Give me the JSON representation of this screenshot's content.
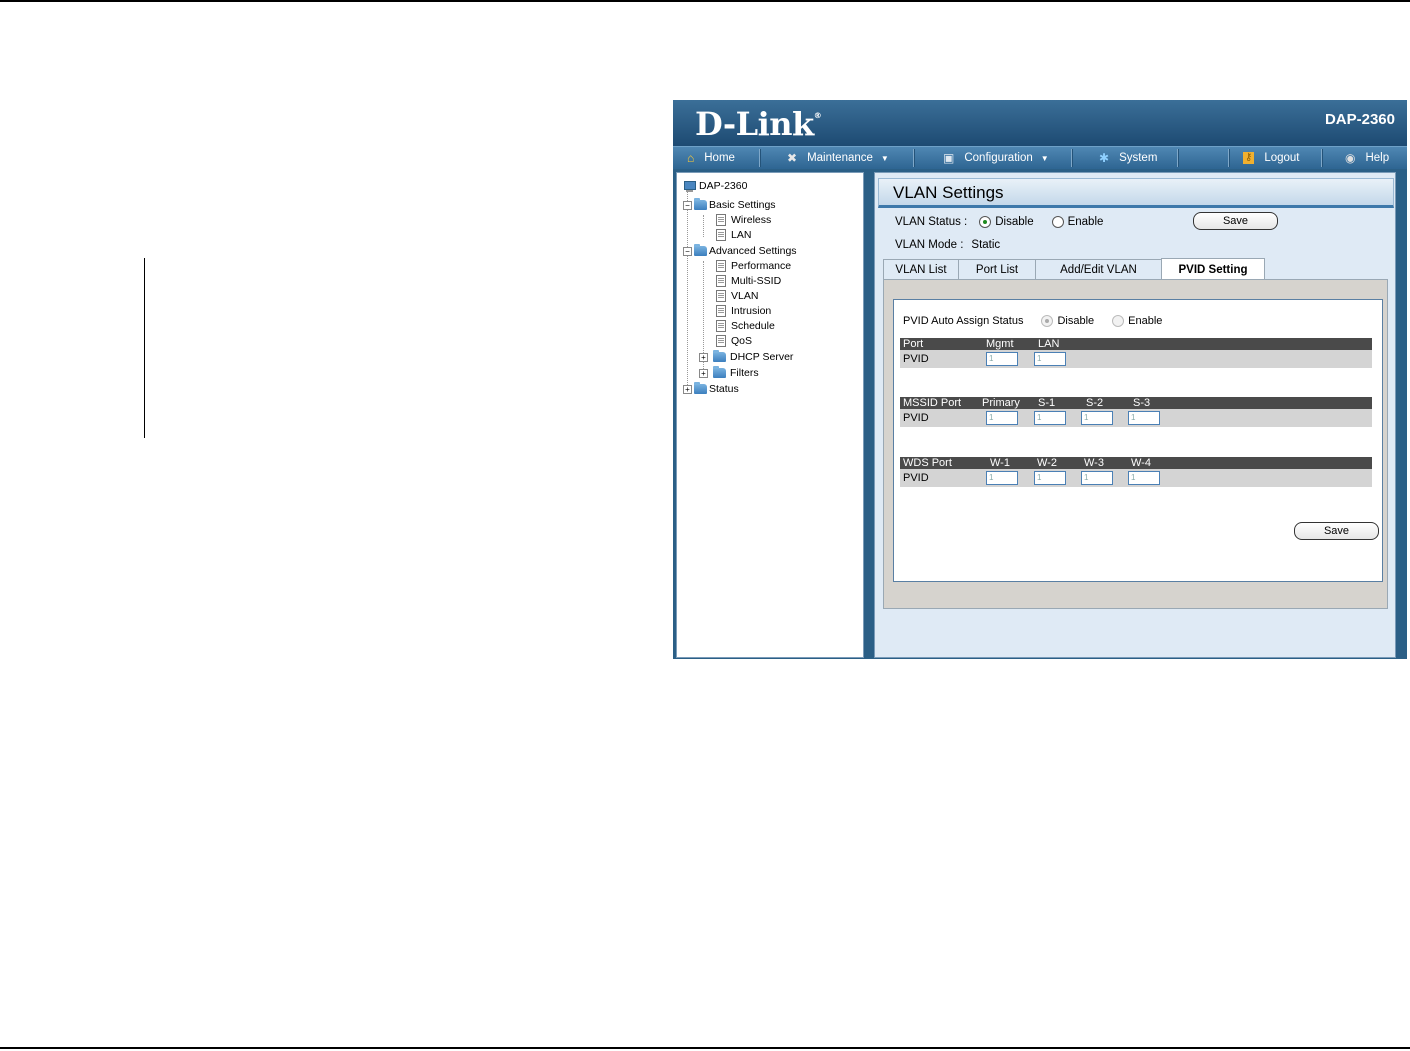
{
  "brand": {
    "logo": "D-Link",
    "model": "DAP-2360"
  },
  "menu": [
    {
      "label": "Home",
      "icon": "home-icon",
      "dropdown": false
    },
    {
      "label": "Maintenance",
      "icon": "tools-icon",
      "dropdown": true
    },
    {
      "label": "Configuration",
      "icon": "save-disk-icon",
      "dropdown": true
    },
    {
      "label": "System",
      "icon": "system-icon",
      "dropdown": false
    },
    {
      "label": "Logout",
      "icon": "key-icon",
      "dropdown": false
    },
    {
      "label": "Help",
      "icon": "help-icon",
      "dropdown": false
    }
  ],
  "tree": {
    "root": "DAP-2360",
    "basic": {
      "label": "Basic Settings",
      "items": [
        "Wireless",
        "LAN"
      ]
    },
    "advanced": {
      "label": "Advanced Settings",
      "items": [
        "Performance",
        "Multi-SSID",
        "VLAN",
        "Intrusion",
        "Schedule",
        "QoS"
      ],
      "folders": [
        "DHCP Server",
        "Filters"
      ]
    },
    "status": "Status"
  },
  "page": {
    "title": "VLAN Settings",
    "vlan_status_label": "VLAN Status :",
    "disable": "Disable",
    "enable": "Enable",
    "save": "Save",
    "vlan_mode_label": "VLAN Mode :",
    "vlan_mode_value": "Static"
  },
  "tabs": [
    "VLAN List",
    "Port List",
    "Add/Edit VLAN",
    "PVID Setting"
  ],
  "pvid": {
    "auto_assign_label": "PVID Auto Assign Status",
    "disable": "Disable",
    "enable": "Enable",
    "port_table": {
      "headers": [
        "Port",
        "Mgmt",
        "LAN"
      ],
      "row_label": "PVID",
      "values": [
        "1",
        "1"
      ]
    },
    "mssid_table": {
      "headers": [
        "MSSID Port",
        "Primary",
        "S-1",
        "S-2",
        "S-3"
      ],
      "row_label": "PVID",
      "values": [
        "1",
        "1",
        "1",
        "1"
      ]
    },
    "wds_table": {
      "headers": [
        "WDS Port",
        "W-1",
        "W-2",
        "W-3",
        "W-4"
      ],
      "row_label": "PVID",
      "values": [
        "1",
        "1",
        "1",
        "1"
      ]
    },
    "save": "Save"
  }
}
